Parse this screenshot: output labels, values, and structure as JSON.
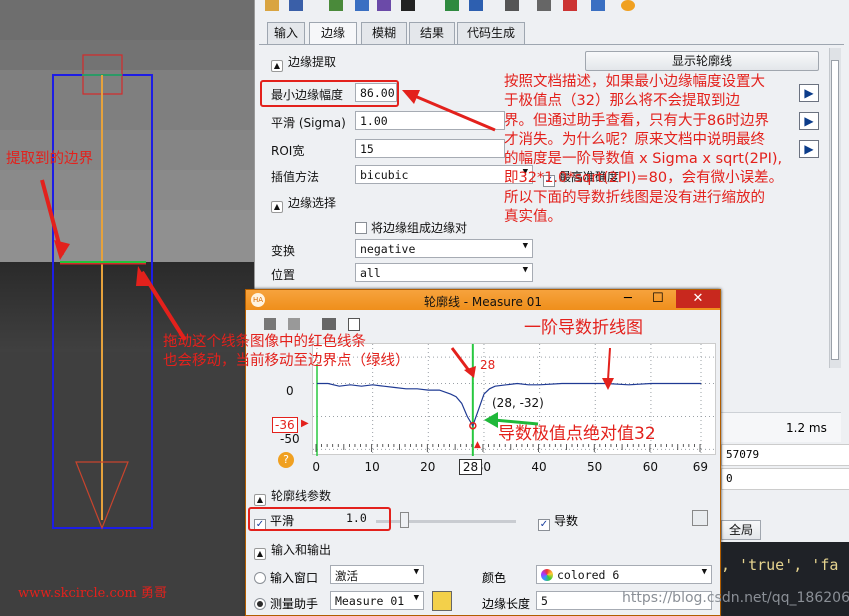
{
  "right_panel": {
    "tabs": [
      "输入",
      "边缘",
      "模糊",
      "结果",
      "代码生成"
    ],
    "active_tab": "边缘",
    "edge_extraction": {
      "title": "边缘提取",
      "show_contour_button": "显示轮廓线",
      "min_amplitude_label": "最小边缘幅度",
      "min_amplitude_value": "86.00",
      "smooth_label": "平滑 (Sigma)",
      "smooth_value": "1.00",
      "roi_width_label": "ROI宽",
      "roi_width_value": "15",
      "interp_label": "插值方法",
      "interp_value": "bicubic",
      "max_precision_label": "最高准确度"
    },
    "edge_selection": {
      "title": "边缘选择",
      "group_label": "将边缘组成边缘对",
      "transform_label": "变换",
      "transform_value": "negative",
      "position_label": "位置",
      "position_value": "all"
    },
    "time_value": "1.2 ms",
    "partial_value_1": "57079",
    "partial_value_2": "0",
    "global_button": "全局",
    "code_text": ", 'true', 'fa"
  },
  "profile_window": {
    "title": "轮廓线 - Measure 01",
    "plot": {
      "y_ticks": [
        "0",
        "-50"
      ],
      "y_marker": "-36",
      "x_ticks": [
        "0",
        "10",
        "20",
        "30",
        "40",
        "50",
        "60",
        "69"
      ],
      "x_marker": "28",
      "top_marker": "28",
      "point_label": "(28, -32)"
    },
    "params_title": "轮廓线参数",
    "smooth_label": "平滑",
    "smooth_value": "1.0",
    "derivative_label": "导数",
    "io_title": "输入和输出",
    "input_window_label": "输入窗口",
    "input_window_value": "激活",
    "color_label": "颜色",
    "color_value": "colored 6",
    "measure_assistant_label": "测量助手",
    "measure_assistant_value": "Measure 01",
    "edge_length_label": "边缘长度",
    "edge_length_value": "5"
  },
  "annotations": {
    "left_edge": "提取到的边界",
    "drag_line": "拖动这个线条图像中的红色线条\n也会移动，当前移动至边界点（绿线）",
    "doc_note": "按照文档描述，如果最小边缘幅度设置大\n于极值点（32）那么将不会提取到边\n界。但通过助手查看，只有大于86时边界\n才消失。为什么呢？原来文档中说明最终\n的幅度是一阶导数值 x Sigma x sqrt(2PI),\n即32*1.0*sqrt(2PI)=80，会有微小误差。\n所以下面的导数折线图是没有进行缩放的\n真实值。",
    "derivative_plot": "一阶导数折线图",
    "extreme_value": "导数极值点绝对值32"
  },
  "watermarks": {
    "site": "www.skcircle.com 勇哥",
    "blog": "https://blog.csdn.net/qq_18620653"
  },
  "chart_data": {
    "type": "line",
    "title": "",
    "xlabel": "",
    "ylabel": "",
    "xlim": [
      0,
      69
    ],
    "ylim": [
      -55,
      30
    ],
    "x": [
      0,
      2,
      4,
      6,
      8,
      10,
      12,
      14,
      16,
      18,
      20,
      22,
      24,
      25,
      26,
      27,
      28,
      29,
      30,
      31,
      32,
      34,
      36,
      38,
      40,
      44,
      48,
      52,
      56,
      60,
      64,
      69
    ],
    "y": [
      0,
      0,
      -2,
      -1,
      -2,
      -1,
      -2,
      -3,
      -4,
      -4,
      -5,
      -5,
      -8,
      -10,
      -15,
      -25,
      -32,
      -20,
      -8,
      -4,
      -2,
      -1,
      0,
      -1,
      -1,
      0,
      0,
      0,
      -1,
      0,
      0,
      0
    ]
  }
}
